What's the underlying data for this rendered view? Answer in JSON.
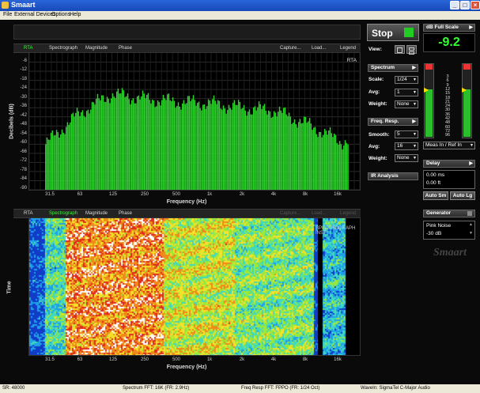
{
  "window": {
    "title": "Smaart",
    "minimize": "_",
    "maximize": "□",
    "close": "×"
  },
  "menu": [
    "File",
    "External Devices",
    "Options",
    "Help"
  ],
  "rta_panel": {
    "tabs": [
      "RTA",
      "Spectrograph",
      "Magnitude",
      "Phase"
    ],
    "right_tabs": [
      "Capture...",
      "Load...",
      "Legend"
    ],
    "plot_tag": "RTA",
    "ylabel": "Decibels (dB)",
    "xlabel": "Frequency (Hz)",
    "yticks": [
      "-6",
      "-12",
      "-18",
      "-24",
      "-30",
      "-36",
      "-42",
      "-48",
      "-54",
      "-60",
      "-66",
      "-72",
      "-78",
      "-84",
      "-90"
    ],
    "xticks": [
      "31.5",
      "63",
      "125",
      "250",
      "500",
      "1k",
      "2k",
      "4k",
      "8k",
      "16k"
    ]
  },
  "spectro_panel": {
    "tabs": [
      "RTA",
      "Spectrograph",
      "Magnitude",
      "Phase"
    ],
    "right_tabs": [
      "Capture...",
      "Load...",
      "Legend"
    ],
    "ylabel": "Time",
    "xlabel": "Frequency (Hz)",
    "xticks": [
      "31.5",
      "63",
      "125",
      "250",
      "500",
      "1k",
      "2k",
      "4k",
      "8k",
      "16k"
    ],
    "overlay_text": "SPECTROGRAPH INST"
  },
  "chart_data": {
    "type": "bar",
    "ylabel": "Decibels (dB)",
    "xlabel": "Frequency (Hz)",
    "ylim": [
      -90,
      0
    ],
    "categories": [
      "31.5",
      "63",
      "125",
      "250",
      "500",
      "1k",
      "2k",
      "4k",
      "8k",
      "16k"
    ],
    "values": [
      -60,
      -40,
      -27,
      -30,
      -32,
      -33,
      -36,
      -38,
      -47,
      -58
    ],
    "colors": {
      "bars": "#2ed12e",
      "grid": "#2a2a2a"
    }
  },
  "controls": {
    "stop_label": "Stop",
    "view_label": "View:",
    "dbfs_header": "dB Full Scale",
    "dbfs_value": "-9.2",
    "meter_scale": [
      "3",
      "6",
      "9",
      "12",
      "15",
      "18",
      "21",
      "24",
      "30",
      "36",
      "42",
      "48",
      "60",
      "72",
      "96"
    ],
    "meas_select": "Meas In / Ref In",
    "spectrum": {
      "header": "Spectrum",
      "scale_label": "Scale:",
      "scale_value": "1/24",
      "avg_label": "Avg:",
      "avg_value": "1",
      "weight_label": "Weight:",
      "weight_value": "None"
    },
    "freq_resp": {
      "header": "Freq. Resp.",
      "smooth_label": "Smooth:",
      "smooth_value": "5",
      "avg_label": "Avg:",
      "avg_value": "16",
      "weight_label": "Weight:",
      "weight_value": "None"
    },
    "ir_analysis": "IR Analysis",
    "delay": {
      "header": "Delay",
      "ms_value": "0.00 ms",
      "ft_value": "0.00 ft",
      "auto_sm": "Auto Sm",
      "auto_lg": "Auto Lg"
    },
    "generator": {
      "header": "Generator",
      "signal": "Pink Noise",
      "level": "-30 dB"
    },
    "logo": "Smaart",
    "colors": {
      "green_value": "#33ff33",
      "stop_indicator": "#22cc22"
    }
  },
  "status": {
    "sr": "SR: 48000",
    "spectrum_fft": "Spectrum FFT: 16K (FR: 2.9Hz)",
    "freq_resp_fft": "Freq Resp FFT: FPPO (FR: 1/24 Oct)",
    "device": "WaveIn: SigmaTel C-Major Audio"
  }
}
